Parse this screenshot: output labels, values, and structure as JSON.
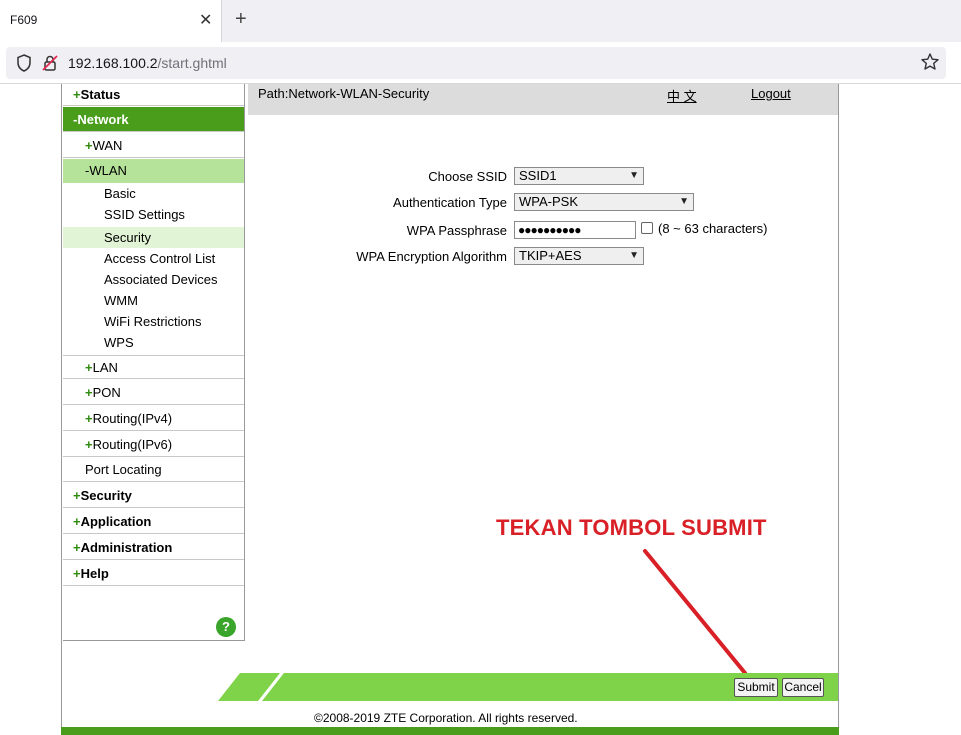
{
  "browser": {
    "tab_title": "F609",
    "tab_close": "✕",
    "new_tab": "+",
    "url_host": "192.168.100.2",
    "url_path": "/start.ghtml"
  },
  "sidebar": {
    "items": [
      {
        "label": "Status",
        "prefix": "+",
        "level": 1
      },
      {
        "label": "Network",
        "prefix": "-",
        "level": 1,
        "active": true
      },
      {
        "label": "WAN",
        "prefix": "+",
        "level": 2
      },
      {
        "label": "WLAN",
        "prefix": "-",
        "level": 2,
        "active": true
      },
      {
        "label": "Basic",
        "level": 3
      },
      {
        "label": "SSID Settings",
        "level": 3
      },
      {
        "label": "Security",
        "level": 3,
        "active": true
      },
      {
        "label": "Access Control List",
        "level": 3
      },
      {
        "label": "Associated Devices",
        "level": 3
      },
      {
        "label": "WMM",
        "level": 3
      },
      {
        "label": "WiFi Restrictions",
        "level": 3
      },
      {
        "label": "WPS",
        "level": 3
      },
      {
        "label": "LAN",
        "prefix": "+",
        "level": 2
      },
      {
        "label": "PON",
        "prefix": "+",
        "level": 2
      },
      {
        "label": "Routing(IPv4)",
        "prefix": "+",
        "level": 2
      },
      {
        "label": "Routing(IPv6)",
        "prefix": "+",
        "level": 2
      },
      {
        "label": "Port Locating",
        "prefix": "",
        "level": 2
      },
      {
        "label": "Security",
        "prefix": "+",
        "level": 1
      },
      {
        "label": "Application",
        "prefix": "+",
        "level": 1
      },
      {
        "label": "Administration",
        "prefix": "+",
        "level": 1
      },
      {
        "label": "Help",
        "prefix": "+",
        "level": 1
      }
    ],
    "help_icon": "?"
  },
  "header": {
    "path": "Path:Network-WLAN-Security",
    "language": "中 文",
    "logout": "Logout"
  },
  "form": {
    "choose_ssid_label": "Choose SSID",
    "choose_ssid_value": "SSID1",
    "auth_type_label": "Authentication Type",
    "auth_type_value": "WPA-PSK",
    "passphrase_label": "WPA Passphrase",
    "passphrase_value": "●●●●●●●●●●",
    "passphrase_hint": "(8 ~ 63 characters)",
    "encryption_label": "WPA Encryption Algorithm",
    "encryption_value": "TKIP+AES"
  },
  "annotation": "TEKAN TOMBOL SUBMIT",
  "buttons": {
    "submit": "Submit",
    "cancel": "Cancel"
  },
  "footer": {
    "copyright": "©2008-2019 ZTE Corporation. All rights reserved."
  },
  "colors": {
    "accent_green": "#4a9d1a",
    "light_green": "#7ed348",
    "annotation_red": "#d92027"
  }
}
